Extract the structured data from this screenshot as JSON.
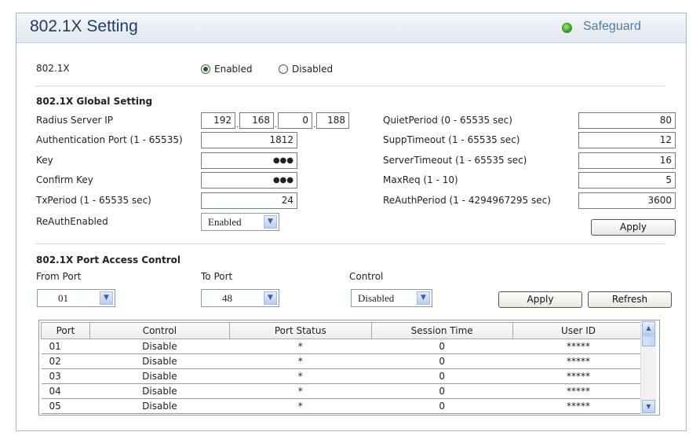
{
  "header": {
    "title": "802.1X Setting",
    "brand": "Safeguard",
    "brand_color": "#4b7ba8",
    "status_dot_color": "#2c9a12"
  },
  "mode": {
    "label": "802.1X",
    "enabled_label": "Enabled",
    "disabled_label": "Disabled",
    "selected": "Enabled"
  },
  "global": {
    "heading": "802.1X Global Setting",
    "radius_label": "Radius Server IP",
    "radius_ip": [
      "192",
      "168",
      "0",
      "188"
    ],
    "auth_port_label": "Authentication Port (1 - 65535)",
    "auth_port": "1812",
    "key_label": "Key",
    "key_value": "●●●",
    "confirm_key_label": "Confirm Key",
    "confirm_key_value": "●●●",
    "txperiod_label": "TxPeriod (1 - 65535 sec)",
    "txperiod": "24",
    "reauth_enabled_label": "ReAuthEnabled",
    "reauth_enabled": "Enabled",
    "quiet_label": "QuietPeriod (0 - 65535 sec)",
    "quiet": "80",
    "supp_label": "SuppTimeout (1 - 65535 sec)",
    "supp": "12",
    "server_label": "ServerTimeout (1 - 65535 sec)",
    "server": "16",
    "maxreq_label": "MaxReq (1 - 10)",
    "maxreq": "5",
    "reauth_period_label": "ReAuthPeriod (1 - 4294967295 sec)",
    "reauth_period": "3600",
    "apply_label": "Apply"
  },
  "port_access": {
    "heading": "802.1X Port Access Control",
    "from_label": "From Port",
    "from_value": "01",
    "to_label": "To Port",
    "to_value": "48",
    "control_label": "Control",
    "control_value": "Disabled",
    "apply_label": "Apply",
    "refresh_label": "Refresh"
  },
  "table": {
    "columns": [
      "Port",
      "Control",
      "Port Status",
      "Session Time",
      "User ID"
    ],
    "rows": [
      [
        "01",
        "Disable",
        "*",
        "0",
        "*****"
      ],
      [
        "02",
        "Disable",
        "*",
        "0",
        "*****"
      ],
      [
        "03",
        "Disable",
        "*",
        "0",
        "*****"
      ],
      [
        "04",
        "Disable",
        "*",
        "0",
        "*****"
      ],
      [
        "05",
        "Disable",
        "*",
        "0",
        "*****"
      ]
    ]
  }
}
